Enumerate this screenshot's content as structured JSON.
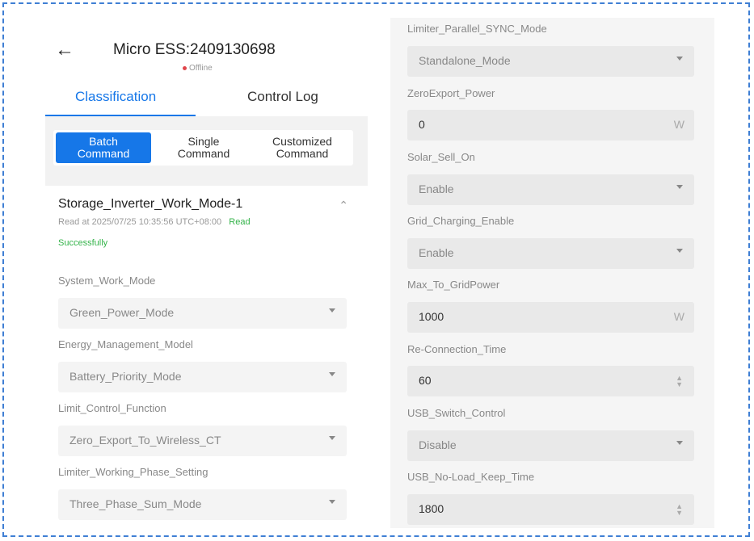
{
  "header": {
    "back_icon": "arrow-left-icon",
    "title": "Micro ESS:2409130698",
    "status": "Offline",
    "status_color": "#e0464b"
  },
  "tabs": [
    {
      "label": "Classification",
      "active": true
    },
    {
      "label": "Control Log",
      "active": false
    }
  ],
  "commands": [
    {
      "line1": "Batch",
      "line2": "Command",
      "active": true
    },
    {
      "line1": "Single",
      "line2": "Command",
      "active": false
    },
    {
      "line1": "Customized",
      "line2": "Command",
      "active": false
    }
  ],
  "card": {
    "title": "Storage_Inverter_Work_Mode-1",
    "read_time": "Read at 2025/07/25 10:35:56 UTC+08:00",
    "read_status_a": "Read",
    "read_status_b": "Successfully",
    "fields": [
      {
        "label": "System_Work_Mode",
        "value": "Green_Power_Mode"
      },
      {
        "label": "Energy_Management_Model",
        "value": "Battery_Priority_Mode"
      },
      {
        "label": "Limit_Control_Function",
        "value": "Zero_Export_To_Wireless_CT"
      },
      {
        "label": "Limiter_Working_Phase_Setting",
        "value": "Three_Phase_Sum_Mode"
      }
    ]
  },
  "right_fields": [
    {
      "label": "Limiter_Parallel_SYNC_Mode",
      "value": "Standalone_Mode",
      "kind": "select"
    },
    {
      "label": "ZeroExport_Power",
      "value": "0",
      "unit": "W",
      "kind": "unit"
    },
    {
      "label": "Solar_Sell_On",
      "value": "Enable",
      "kind": "select"
    },
    {
      "label": "Grid_Charging_Enable",
      "value": "Enable",
      "kind": "select"
    },
    {
      "label": "Max_To_GridPower",
      "value": "1000",
      "unit": "W",
      "kind": "unit"
    },
    {
      "label": "Re-Connection_Time",
      "value": "60",
      "kind": "spin"
    },
    {
      "label": "USB_Switch_Control",
      "value": "Disable",
      "kind": "select"
    },
    {
      "label": "USB_No-Load_Keep_Time",
      "value": "1800",
      "kind": "spin"
    }
  ],
  "colors": {
    "accent": "#1677e8",
    "success": "#34b34a",
    "frame": "#3f7fd4"
  }
}
